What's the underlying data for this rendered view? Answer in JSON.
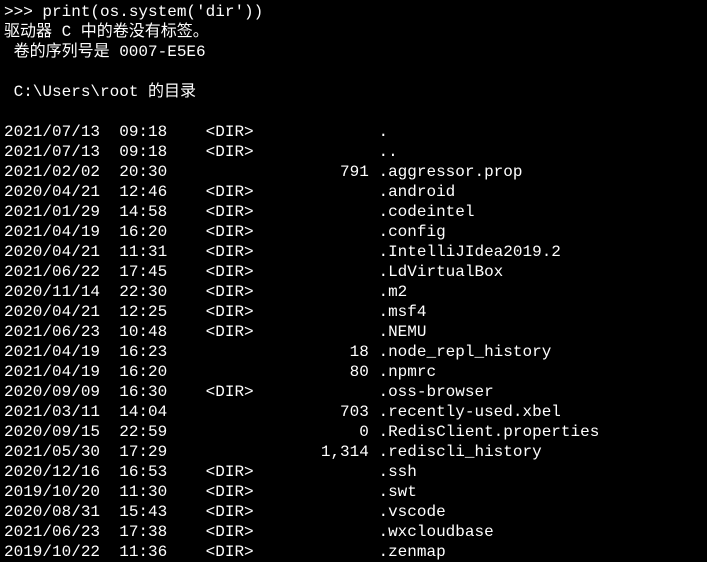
{
  "prompt": ">>> print(os.system('dir'))",
  "header1": "驱动器 C 中的卷没有标签。",
  "header2": " 卷的序列号是 0007-E5E6",
  "dirof": " C:\\Users\\root 的目录",
  "rows": [
    {
      "date": "2021/07/13",
      "time": "09:18",
      "type": "<DIR>",
      "size": "",
      "name": "."
    },
    {
      "date": "2021/07/13",
      "time": "09:18",
      "type": "<DIR>",
      "size": "",
      "name": ".."
    },
    {
      "date": "2021/02/02",
      "time": "20:30",
      "type": "",
      "size": "791",
      "name": ".aggressor.prop"
    },
    {
      "date": "2020/04/21",
      "time": "12:46",
      "type": "<DIR>",
      "size": "",
      "name": ".android"
    },
    {
      "date": "2021/01/29",
      "time": "14:58",
      "type": "<DIR>",
      "size": "",
      "name": ".codeintel"
    },
    {
      "date": "2021/04/19",
      "time": "16:20",
      "type": "<DIR>",
      "size": "",
      "name": ".config"
    },
    {
      "date": "2020/04/21",
      "time": "11:31",
      "type": "<DIR>",
      "size": "",
      "name": ".IntelliJIdea2019.2"
    },
    {
      "date": "2021/06/22",
      "time": "17:45",
      "type": "<DIR>",
      "size": "",
      "name": ".LdVirtualBox"
    },
    {
      "date": "2020/11/14",
      "time": "22:30",
      "type": "<DIR>",
      "size": "",
      "name": ".m2"
    },
    {
      "date": "2020/04/21",
      "time": "12:25",
      "type": "<DIR>",
      "size": "",
      "name": ".msf4"
    },
    {
      "date": "2021/06/23",
      "time": "10:48",
      "type": "<DIR>",
      "size": "",
      "name": ".NEMU"
    },
    {
      "date": "2021/04/19",
      "time": "16:23",
      "type": "",
      "size": "18",
      "name": ".node_repl_history"
    },
    {
      "date": "2021/04/19",
      "time": "16:20",
      "type": "",
      "size": "80",
      "name": ".npmrc"
    },
    {
      "date": "2020/09/09",
      "time": "16:30",
      "type": "<DIR>",
      "size": "",
      "name": ".oss-browser"
    },
    {
      "date": "2021/03/11",
      "time": "14:04",
      "type": "",
      "size": "703",
      "name": ".recently-used.xbel"
    },
    {
      "date": "2020/09/15",
      "time": "22:59",
      "type": "",
      "size": "0",
      "name": ".RedisClient.properties"
    },
    {
      "date": "2021/05/30",
      "time": "17:29",
      "type": "",
      "size": "1,314",
      "name": ".rediscli_history"
    },
    {
      "date": "2020/12/16",
      "time": "16:53",
      "type": "<DIR>",
      "size": "",
      "name": ".ssh"
    },
    {
      "date": "2019/10/20",
      "time": "11:30",
      "type": "<DIR>",
      "size": "",
      "name": ".swt"
    },
    {
      "date": "2020/08/31",
      "time": "15:43",
      "type": "<DIR>",
      "size": "",
      "name": ".vscode"
    },
    {
      "date": "2021/06/23",
      "time": "17:38",
      "type": "<DIR>",
      "size": "",
      "name": ".wxcloudbase"
    },
    {
      "date": "2019/10/22",
      "time": "11:36",
      "type": "<DIR>",
      "size": "",
      "name": ".zenmap"
    }
  ]
}
